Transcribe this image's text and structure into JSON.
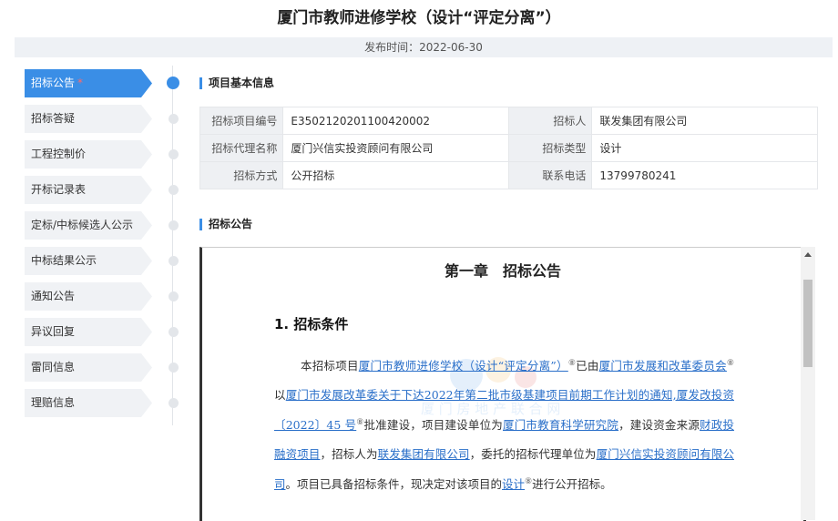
{
  "page": {
    "title": "厦门市教师进修学校（设计“评定分离”）",
    "publish_time": "发布时间：2022-06-30"
  },
  "nav": {
    "items": [
      {
        "label": "招标公告",
        "star": "*",
        "active": true
      },
      {
        "label": "招标答疑"
      },
      {
        "label": "工程控制价"
      },
      {
        "label": "开标记录表"
      },
      {
        "label": "定标/中标候选人公示"
      },
      {
        "label": "中标结果公示"
      },
      {
        "label": "通知公告"
      },
      {
        "label": "异议回复"
      },
      {
        "label": "雷同信息"
      },
      {
        "label": "理赔信息"
      }
    ]
  },
  "info": {
    "heading": "项目基本信息",
    "rows": [
      [
        {
          "key": "招标项目编号",
          "value": "E3502120201100420002"
        },
        {
          "key": "招标人",
          "value": "联发集团有限公司"
        }
      ],
      [
        {
          "key": "招标代理名称",
          "value": "厦门兴信实投资顾问有限公司"
        },
        {
          "key": "招标类型",
          "value": "设计"
        }
      ],
      [
        {
          "key": "招标方式",
          "value": "公开招标"
        },
        {
          "key": "联系电话",
          "value": "13799780241"
        }
      ]
    ]
  },
  "notice": {
    "heading": "招标公告",
    "chapter": "第一章　招标公告",
    "section": "1. 招标条件",
    "p": {
      "t1": "本招标项目",
      "l1": "厦门市教师进修学校（设计“评定分离”）",
      "t2": "已由",
      "l2": "厦门市发展和改革委员会",
      "t3": "以",
      "l3": "厦门市发展改革委关于下达2022年第二批市级基建项目前期工作计划的通知,厦发改投资〔2022〕45 号",
      "t4": "批准建设，项目建设单位为",
      "l4": "厦门市教育科学研究院",
      "t5": "，建设资金来源",
      "l5": "财政投融资项目",
      "t6": "，招标人为",
      "l6": "联发集团有限公司",
      "t7": "，委托的招标代理单位为",
      "l7": "厦门兴信实投资顾问有限公司",
      "t8": "。项目已具备招标条件，现决定对该项目的",
      "l8": "设计",
      "t9": "进行公开招标。",
      "mark": "⑧"
    },
    "watermark": "厦 门 房 地 产 联 合 网"
  },
  "colors": {
    "accent": "#3a8ee6",
    "link": "#2a6fc9"
  }
}
